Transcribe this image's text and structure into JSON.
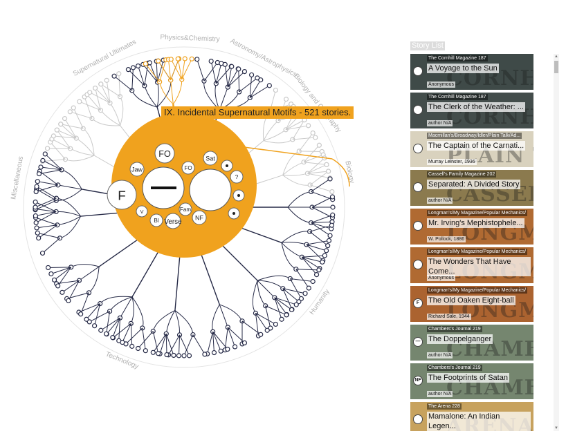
{
  "viz": {
    "categories": [
      "Supernatural Ultimates",
      "Physics&Chemistry",
      "Astronomy/Astrophysics",
      "Biology and Geography",
      "Biology",
      "Humanity",
      "Technology",
      "Miscellaneous"
    ],
    "tooltip": "IX. Incidental Supernatural Motifs - 521 stories.",
    "motif_labels": [
      "F",
      "FO",
      "Sat",
      "Jaw",
      "FO",
      "?",
      "V",
      "Bl",
      "Verse",
      "Fam",
      "NF"
    ],
    "colors": {
      "accent": "#f0a21e",
      "tree": "#252946",
      "muted": "#c9c9c9"
    }
  },
  "panel": {
    "title": "Story List"
  },
  "stories": [
    {
      "magazine": "The Cornhill Magazine 187",
      "title": "A Voyage to the Sun",
      "author": "Anonymous",
      "motif": "dot-icon",
      "motif_text": "",
      "cover": "#3f4a48",
      "mast": "CORNHILL"
    },
    {
      "magazine": "The Cornhill Magazine 187",
      "title": "The Clerk of the Weather: ...",
      "author": "author N/A",
      "motif": "dot-icon",
      "motif_text": "",
      "cover": "#434d4b",
      "mast": "CORNHILL"
    },
    {
      "magazine": "Macmillan's/Broadway/Idler/Plain Talk/Ad...",
      "title": "The Captain of the Carnati...",
      "author": "Murray Leinster, 1936",
      "motif": "dot-icon",
      "motif_text": "",
      "cover": "#d9d2be",
      "mast": "PLAIN TALK"
    },
    {
      "magazine": "Cassell's Family Magazine 202",
      "title": "Separated: A Divided Story",
      "author": "author N/A",
      "motif": "ring-icon",
      "motif_text": "",
      "cover": "#8b7a4e",
      "mast": "CASSELL'S"
    },
    {
      "magazine": "Longman's/My Magazine/Popular Mechanics/",
      "title": "Mr. Irving's Mephistophele...",
      "author": "W. Pollock, 1886",
      "motif": "blank-icon",
      "motif_text": "",
      "cover": "#b06a32",
      "mast": "LONGMAN'S"
    },
    {
      "magazine": "Longman's/My Magazine/Popular Mechanics/",
      "title": "The Wonders That Have Come...",
      "author": "Anonymous",
      "motif": "blank-icon",
      "motif_text": "",
      "cover": "#b06a32",
      "mast": "LONGMAN'S"
    },
    {
      "magazine": "Longman's/My Magazine/Popular Mechanics/",
      "title": "The Old Oaken Eight-ball",
      "author": "Richard Sale, 1944",
      "motif": "letter-f-icon",
      "motif_text": "F",
      "cover": "#ab6330",
      "mast": "LONGMAN'S"
    },
    {
      "magazine": "Chambers's Journal 219",
      "title": "The Doppelganger",
      "author": "author N/A",
      "motif": "dash-icon",
      "motif_text": "—",
      "cover": "#75866f",
      "mast": "CHAMBERS'S"
    },
    {
      "magazine": "Chambers's Journal 219",
      "title": "The Footprints of Satan",
      "author": "author N/A",
      "motif": "nf-icon",
      "motif_text": "NF",
      "cover": "#75866f",
      "mast": "CHAMBERS'S"
    },
    {
      "magazine": "The Arena 228",
      "title": "Mamalone: An Indian Legen...",
      "author": "",
      "motif": "dot-icon",
      "motif_text": "",
      "cover": "#c7a25e",
      "mast": "ARENA"
    }
  ]
}
